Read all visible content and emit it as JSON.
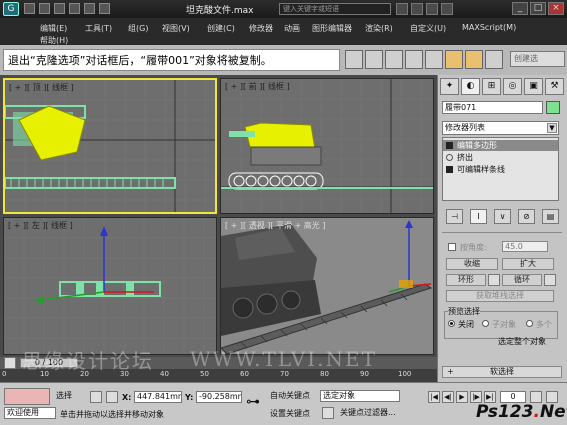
{
  "titlebar": {
    "title": "坦克酸文件.max",
    "search_placeholder": "键入关键字或短语"
  },
  "menubar": {
    "items": [
      "编辑(E)",
      "工具(T)",
      "组(G)",
      "视图(V)",
      "创建(C)",
      "修改器",
      "动画",
      "图形编辑器",
      "渲染(R)",
      "自定义(U)",
      "MAXScript(M)",
      "帮助(H)"
    ]
  },
  "toolbar": {
    "caption": "退出“克隆选项”对话框后，“履带001”对象将被复制。",
    "create_selection_set": "创建选"
  },
  "viewports": {
    "top": "[ + ][ 顶 ][ 线框 ]",
    "front": "[ + ][ 前 ][ 线框 ]",
    "left": "[ + ][ 左 ][ 线框 ]",
    "perspective": "[ + ][ 透视 ][ 平滑 + 高光 ]"
  },
  "command_panel": {
    "object_name": "履带071",
    "modifier_list": "修改器列表",
    "stack": [
      "编辑多边形",
      "挤出",
      "可编辑样条线"
    ],
    "soft_selection": "按角度:",
    "angle_value": "45.0",
    "buttons": {
      "shrink": "收缩",
      "grow": "扩大",
      "ring": "环形",
      "loop": "循环",
      "get_stack_selection": "获取堆栈选择"
    },
    "preview_selection": "预览选择",
    "radio_off": "关闭",
    "radio_subobject": "子对象",
    "radio_multi": "多个",
    "select_whole": "选定整个对象",
    "soft_selection_rollout": "软选择",
    "rollout_plus": "+"
  },
  "timeline": {
    "slider": "0 / 100",
    "ticks": [
      "0",
      "10",
      "20",
      "30",
      "40",
      "50",
      "60",
      "70",
      "80",
      "90",
      "100"
    ]
  },
  "statusbar": {
    "welcome": "欢迎使用",
    "selected": "选择",
    "x_label": "X:",
    "x_value": "447.841mr",
    "y_label": "Y:",
    "y_value": "-90.258mm",
    "prompt": "单击并拖动以选择并移动对象",
    "auto_key": "自动关键点",
    "set_key": "设置关键点",
    "selection_dropdown": "选定对象",
    "key_filters": "关键点过滤器...",
    "frame": "0"
  },
  "watermark": {
    "left": "思缘设计论坛",
    "right": "WWW.TLVI.NET"
  },
  "logo": {
    "ps": "Ps123",
    "dot": ".",
    "net": "Net"
  },
  "colors": {
    "active_viewport_border": "#f0e63c",
    "selected_mesh": "#e6f000",
    "object_color": "#7fe08f"
  }
}
